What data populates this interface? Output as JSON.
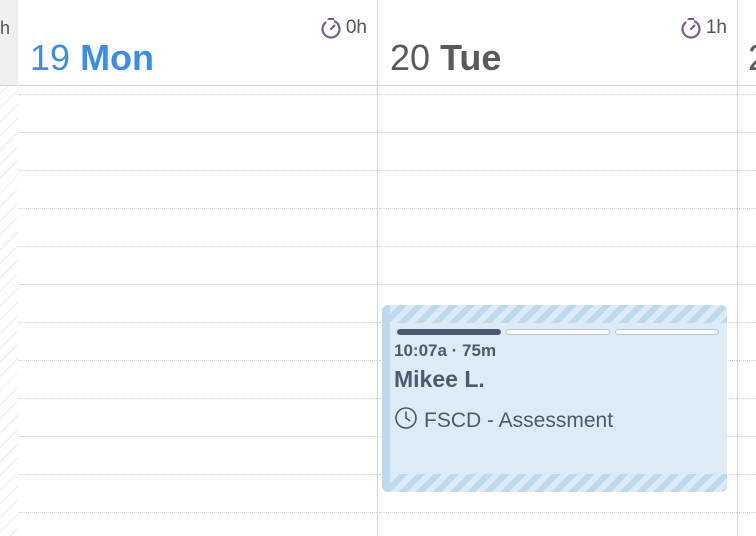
{
  "gutter": {
    "label_fragment": "h"
  },
  "days": [
    {
      "number": "19",
      "weekday": "Mon",
      "is_today": true,
      "hours_logged": "0h"
    },
    {
      "number": "20",
      "weekday": "Tue",
      "is_today": false,
      "hours_logged": "1h"
    },
    {
      "number": "2",
      "weekday": "",
      "is_today": false,
      "hours_logged": ""
    }
  ],
  "event": {
    "time": "10:07a · 75m",
    "client": "Mikee L.",
    "service": "FSCD - Assessment",
    "progress_segments_total": 3,
    "progress_segments_done": 1
  },
  "colors": {
    "today_accent": "#3a8ee6",
    "timer_icon": "#7b5a8e",
    "event_bg": "#dcebf6",
    "event_stripe": "#bcd9ee",
    "event_text": "#4b5a6e"
  }
}
